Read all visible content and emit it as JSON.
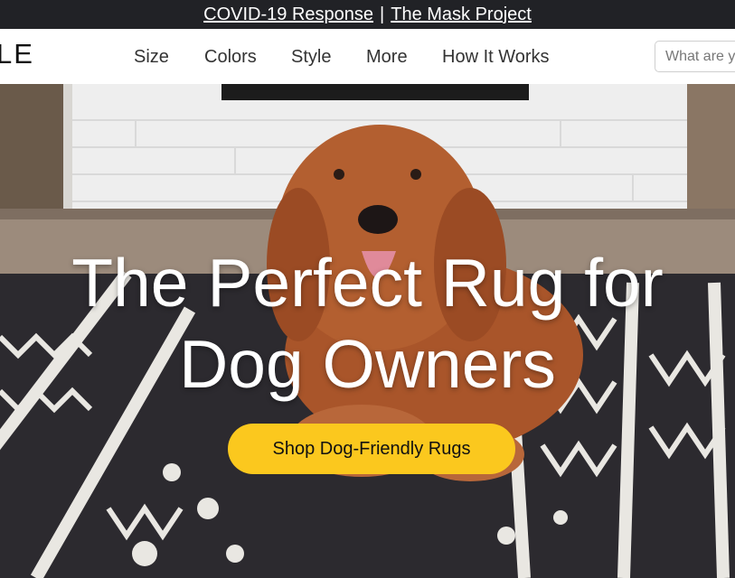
{
  "announcement": {
    "link1": "COVID-19 Response",
    "separator": "|",
    "link2": "The Mask Project"
  },
  "header": {
    "logo_text": "LE",
    "nav": [
      "Size",
      "Colors",
      "Style",
      "More",
      "How It Works"
    ],
    "search_placeholder": "What are you looking for?"
  },
  "hero": {
    "title_line1": "The Perfect Rug for",
    "title_line2": "Dog Owners",
    "cta_label": "Shop Dog-Friendly Rugs",
    "image_subject": "dog-on-rug-photo"
  },
  "colors": {
    "announcement_bg": "#212226",
    "cta_bg": "#fbc81e"
  }
}
